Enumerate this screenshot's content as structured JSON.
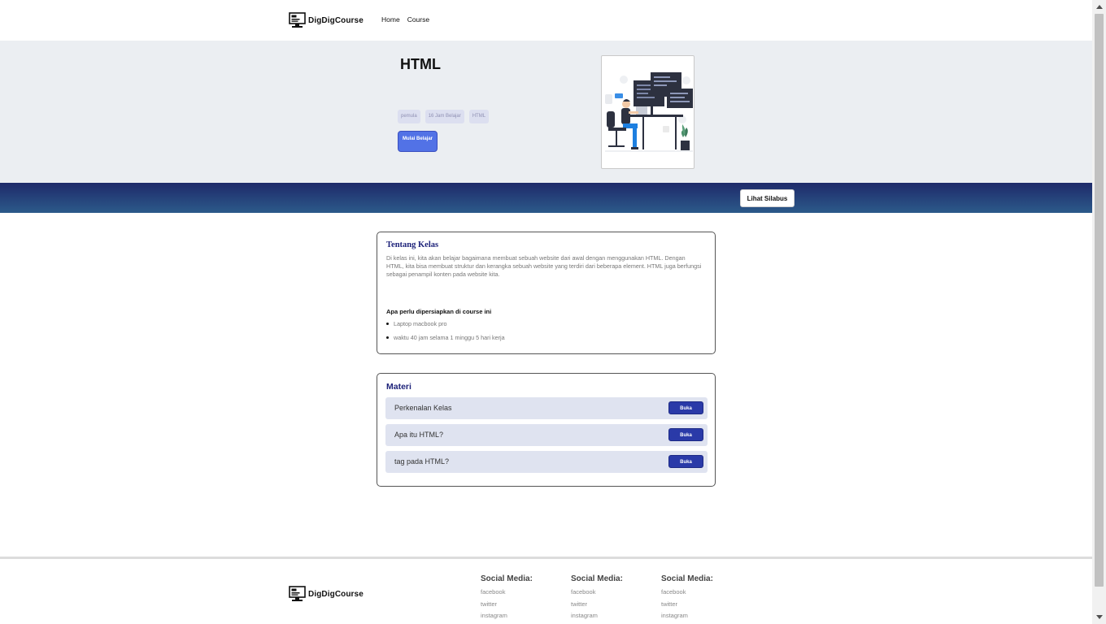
{
  "nav": {
    "brand": "DigDigCourse",
    "links": [
      "Home",
      "Course"
    ]
  },
  "hero": {
    "title": "HTML",
    "tags": [
      "pemula",
      "16 Jam Belajar",
      "HTML"
    ],
    "start_label": "Mulai Belajar",
    "image_icon": "developer-illustration"
  },
  "band": {
    "silabus_label": "Lihat Silabus"
  },
  "about": {
    "title": "Tentang Kelas",
    "description": "Di kelas ini, kita akan belajar bagaimana membuat sebuah website dari awal dengan menggunakan HTML. Dengan HTML, kita bisa membuat struktur dan kerangka sebuah website yang terdiri dari beberapa element. HTML juga berfungsi sebagai penampil konten pada website kita.",
    "prep_title": "Apa perlu dipersiapkan di course ini",
    "prep_items": [
      "Laptop macbook pro",
      "waktu 40 jam selama 1 minggu 5 hari kerja"
    ]
  },
  "materi": {
    "title": "Materi",
    "items": [
      {
        "label": "Perkenalan Kelas",
        "button": "Buka"
      },
      {
        "label": "Apa itu HTML?",
        "button": "Buka"
      },
      {
        "label": "tag pada HTML?",
        "button": "Buka"
      }
    ]
  },
  "footer": {
    "brand": "DigDigCourse",
    "columns": [
      {
        "heading": "Social Media:",
        "links": [
          "facebook",
          "twitter",
          "instagram"
        ]
      },
      {
        "heading": "Social Media:",
        "links": [
          "facebook",
          "twitter",
          "instagram"
        ]
      },
      {
        "heading": "Social Media:",
        "links": [
          "facebook",
          "twitter",
          "instagram"
        ]
      }
    ]
  },
  "colors": {
    "accent": "#1e237a",
    "button_primary": "#5272e6",
    "button_dark": "#2a3aa8",
    "hero_bg": "#ebeef2",
    "band_top": "#1e2a6a",
    "band_bottom": "#2c5a8a"
  }
}
